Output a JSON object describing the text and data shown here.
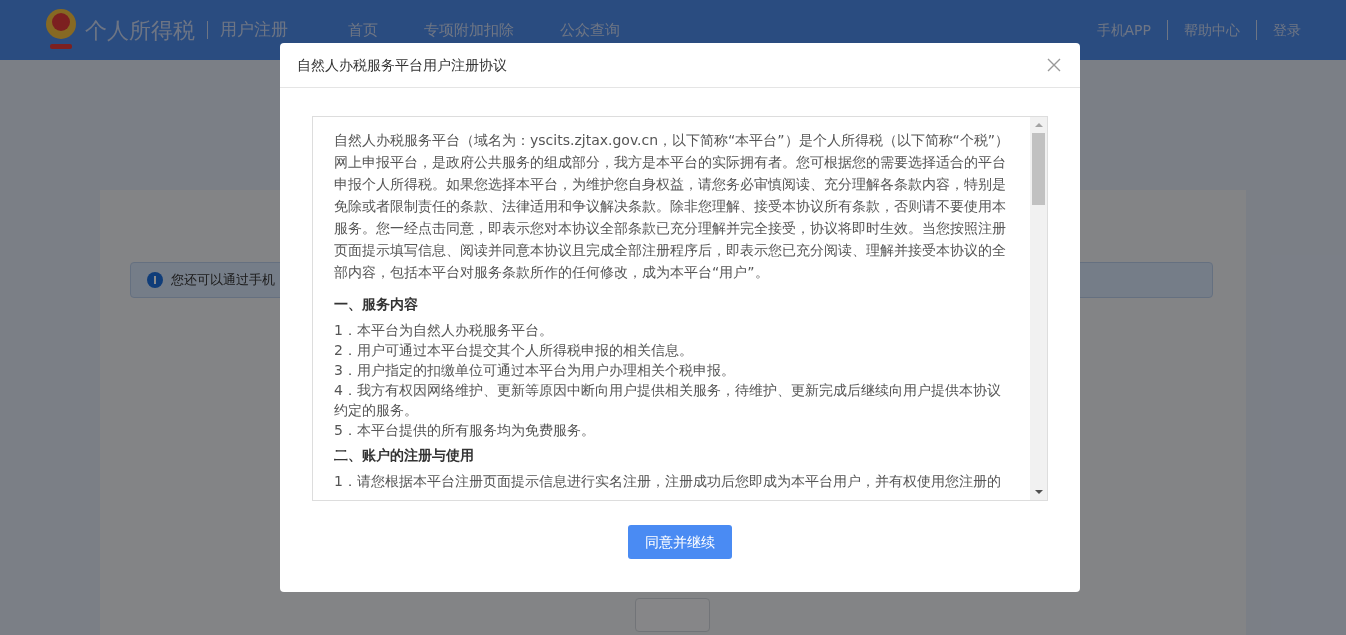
{
  "header": {
    "title": "个人所得税",
    "subtitle": "用户注册",
    "nav": [
      "首页",
      "专项附加扣除",
      "公众查询"
    ],
    "links": [
      "手机APP",
      "帮助中心",
      "登录"
    ]
  },
  "notice": {
    "text": "您还可以通过手机"
  },
  "modal": {
    "title": "自然人办税服务平台用户注册协议",
    "sections": [
      {
        "kind": "paragraph",
        "text": "自然人办税服务平台（域名为：yscits.zjtax.gov.cn，以下简称“本平台”）是个人所得税（以下简称“个税”）网上申报平台，是政府公共服务的组成部分，我方是本平台的实际拥有者。您可根据您的需要选择适合的平台申报个人所得税。如果您选择本平台，为维护您自身权益，请您务必审慎阅读、充分理解各条款内容，特别是免除或者限制责任的条款、法律适用和争议解决条款。除非您理解、接受本协议所有条款，否则请不要使用本服务。您一经点击同意，即表示您对本协议全部条款已充分理解并完全接受，协议将即时生效。当您按照注册页面提示填写信息、阅读并同意本协议且完成全部注册程序后，即表示您已充分阅读、理解并接受本协议的全部内容，包括本平台对服务条款所作的任何修改，成为本平台“用户”。"
      },
      {
        "kind": "heading",
        "text": "一、服务内容"
      },
      {
        "kind": "item",
        "text": "1．本平台为自然人办税服务平台。"
      },
      {
        "kind": "item",
        "text": "2．用户可通过本平台提交其个人所得税申报的相关信息。"
      },
      {
        "kind": "item",
        "text": "3．用户指定的扣缴单位可通过本平台为用户办理相关个税申报。"
      },
      {
        "kind": "item",
        "text": "4．我方有权因网络维护、更新等原因中断向用户提供相关服务，待维护、更新完成后继续向用户提供本协议约定的服务。"
      },
      {
        "kind": "item",
        "text": "5．本平台提供的所有服务均为免费服务。"
      },
      {
        "kind": "heading",
        "text": "二、账户的注册与使用"
      },
      {
        "kind": "item",
        "text": "1．请您根据本平台注册页面提示信息进行实名注册，注册成功后您即成为本平台用户，并有权使用您注册的"
      }
    ],
    "button": "同意并继续"
  }
}
